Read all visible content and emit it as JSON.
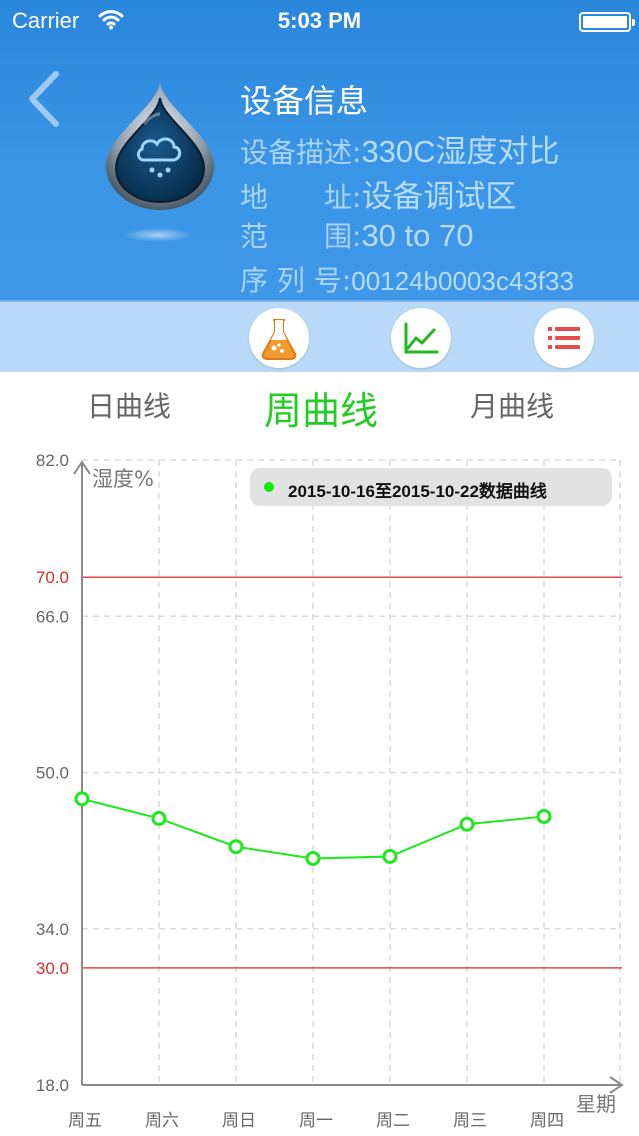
{
  "status_bar": {
    "carrier": "Carrier",
    "time": "5:03 PM"
  },
  "device": {
    "title": "设备信息",
    "description_label": "设备描述:",
    "description_value": "330C湿度对比",
    "address_label": "地　　址:",
    "address_value": "设备调试区",
    "range_label": "范　　围:",
    "range_value": "30 to 70",
    "serial_label": "序 列 号:",
    "serial_value": "00124b0003c43f33",
    "icon": "water-drop-cloud-icon"
  },
  "toolbar": {
    "buttons": [
      "flask-icon",
      "line-chart-icon",
      "list-icon"
    ]
  },
  "tabs": [
    "日曲线",
    "周曲线",
    "月曲线"
  ],
  "active_tab": "周曲线",
  "colors": {
    "accent_green": "#22cc22",
    "limit_red": "#e8474a",
    "header_blue": "#2f8fe2"
  },
  "chart_data": {
    "type": "line",
    "ylabel": "湿度%",
    "xlabel": "星期",
    "ylim": [
      18,
      82
    ],
    "y_ticks": [
      "82.0",
      "66.0",
      "50.0",
      "34.0",
      "18.0"
    ],
    "limit_lines": [
      {
        "label": "70.0",
        "value": 70
      },
      {
        "label": "30.0",
        "value": 30
      }
    ],
    "categories": [
      "周五",
      "周六",
      "周日",
      "周一",
      "周二",
      "周三",
      "周四"
    ],
    "series": [
      {
        "name": "2015-10-16至2015-10-22数据曲线",
        "color": "#1ee81e",
        "values": [
          47.3,
          45.3,
          42.4,
          41.2,
          41.4,
          44.7,
          45.5
        ]
      }
    ],
    "grid": true,
    "legend": "top-right"
  }
}
